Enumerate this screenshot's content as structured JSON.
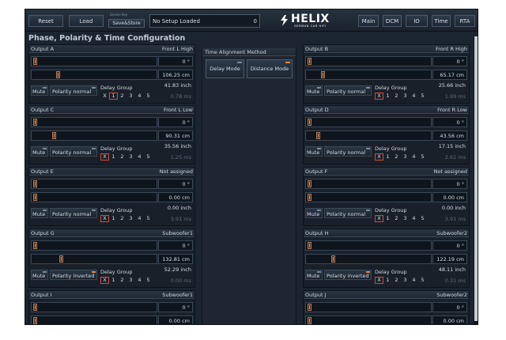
{
  "toolbar": {
    "reset": "Reset",
    "load": "Load",
    "memory_label": "Device Key",
    "save_store": "Save&Store",
    "setup_name": "No Setup Loaded",
    "setup_number": "0",
    "nav": [
      "Main",
      "DCM",
      "IO",
      "Time",
      "RTA"
    ]
  },
  "logo": {
    "word": "HELIX",
    "sub": "GERMAN CAR HIFI"
  },
  "page_title": "Phase, Polarity & Time Configuration",
  "time_alignment": {
    "title": "Time Alignment Method",
    "delay_mode": "Delay Mode",
    "distance_mode": "Distance Mode"
  },
  "labels": {
    "mute": "Mute",
    "delay_group": "Delay Group",
    "group_options": [
      "X",
      "1",
      "2",
      "3",
      "4",
      "5"
    ]
  },
  "left_panels": [
    {
      "name": "Output A",
      "assignment": "Front L High",
      "phase": "0 °",
      "cm": "106.25 cm",
      "inch": "41.83 inch",
      "ms": "0.78 ms",
      "polarity": "Polarity normal",
      "inverted": false,
      "group": "1",
      "delay_level": 0.19
    },
    {
      "name": "Output C",
      "assignment": "Front L Low",
      "phase": "0 °",
      "cm": "90.31 cm",
      "inch": "35.56 inch",
      "ms": "1.25 ms",
      "polarity": "Polarity normal",
      "inverted": false,
      "group": "X",
      "delay_level": 0.16
    },
    {
      "name": "Output E",
      "assignment": "Not assigned",
      "phase": "0 °",
      "cm": "0.00 cm",
      "inch": "0.00 inch",
      "ms": "3.91 ms",
      "polarity": "Polarity normal",
      "inverted": false,
      "group": "X",
      "delay_level": 0.0
    },
    {
      "name": "Output G",
      "assignment": "Subwoofer1",
      "phase": "0 °",
      "cm": "132.81 cm",
      "inch": "52.29 inch",
      "ms": "0.00 ms",
      "polarity": "Polarity inverted",
      "inverted": true,
      "group": "X",
      "delay_level": 0.22
    },
    {
      "name": "Output I",
      "assignment": "Subwoofer1",
      "phase": "0 °",
      "cm": "0.00 cm",
      "inch": "",
      "ms": "",
      "polarity": "",
      "inverted": false,
      "group": "X",
      "delay_level": 0.0
    }
  ],
  "right_panels": [
    {
      "name": "Output B",
      "assignment": "Front R High",
      "phase": "0 °",
      "cm": "65.17 cm",
      "inch": "25.66 inch",
      "ms": "1.99 ms",
      "polarity": "Polarity normal",
      "inverted": false,
      "group": "X",
      "delay_level": 0.11
    },
    {
      "name": "Output D",
      "assignment": "Front R Low",
      "phase": "0 °",
      "cm": "43.56 cm",
      "inch": "17.15 inch",
      "ms": "2.61 ms",
      "polarity": "Polarity normal",
      "inverted": false,
      "group": "X",
      "delay_level": 0.07
    },
    {
      "name": "Output F",
      "assignment": "Not assigned",
      "phase": "0 °",
      "cm": "0.00 cm",
      "inch": "0.00 inch",
      "ms": "3.91 ms",
      "polarity": "Polarity normal",
      "inverted": false,
      "group": "X",
      "delay_level": 0.0
    },
    {
      "name": "Output H",
      "assignment": "Subwoofer2",
      "phase": "0 °",
      "cm": "122.19 cm",
      "inch": "48.11 inch",
      "ms": "0.31 ms",
      "polarity": "Polarity inverted",
      "inverted": true,
      "group": "X",
      "delay_level": 0.2
    },
    {
      "name": "Output J",
      "assignment": "Subwoofer2",
      "phase": "0 °",
      "cm": "0.00 cm",
      "inch": "",
      "ms": "",
      "polarity": "",
      "inverted": false,
      "group": "X",
      "delay_level": 0.0
    }
  ],
  "colors": {
    "background": "#1b2430",
    "accent": "#e08a40",
    "group_selected": "#d04a3a"
  }
}
